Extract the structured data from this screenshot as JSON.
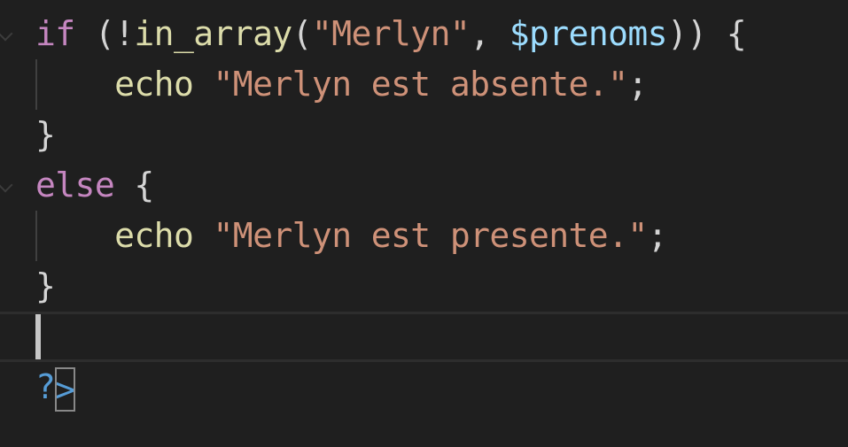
{
  "editor": {
    "lines": [
      {
        "tokens": [
          {
            "t": "if",
            "c": "kw"
          },
          {
            "t": " (!",
            "c": "pun"
          },
          {
            "t": "in_array",
            "c": "fn"
          },
          {
            "t": "(",
            "c": "pun"
          },
          {
            "t": "\"Merlyn\"",
            "c": "str"
          },
          {
            "t": ", ",
            "c": "pun"
          },
          {
            "t": "$prenoms",
            "c": "var"
          },
          {
            "t": ")) {",
            "c": "pun"
          }
        ]
      },
      {
        "tokens": [
          {
            "t": "    ",
            "c": "pun"
          },
          {
            "t": "echo",
            "c": "fn"
          },
          {
            "t": " ",
            "c": "pun"
          },
          {
            "t": "\"Merlyn est absente.\"",
            "c": "str"
          },
          {
            "t": ";",
            "c": "pun"
          }
        ]
      },
      {
        "tokens": [
          {
            "t": "}",
            "c": "pun"
          }
        ]
      },
      {
        "tokens": [
          {
            "t": "else",
            "c": "kw"
          },
          {
            "t": " {",
            "c": "pun"
          }
        ]
      },
      {
        "tokens": [
          {
            "t": "    ",
            "c": "pun"
          },
          {
            "t": "echo",
            "c": "fn"
          },
          {
            "t": " ",
            "c": "pun"
          },
          {
            "t": "\"Merlyn est presente.\"",
            "c": "str"
          },
          {
            "t": ";",
            "c": "pun"
          }
        ]
      },
      {
        "tokens": [
          {
            "t": "}",
            "c": "pun"
          }
        ]
      },
      {
        "tokens": []
      },
      {
        "tokens": [
          {
            "t": "?",
            "c": "tag"
          },
          {
            "t": ">",
            "c": "tag"
          }
        ]
      }
    ]
  },
  "colors": {
    "background": "#1f1f1f",
    "keyword": "#c586c0",
    "function": "#dcdcaa",
    "string": "#ce9178",
    "variable": "#9cdcfe",
    "punctuation": "#d4d4d4",
    "php_tag": "#569cd6"
  }
}
